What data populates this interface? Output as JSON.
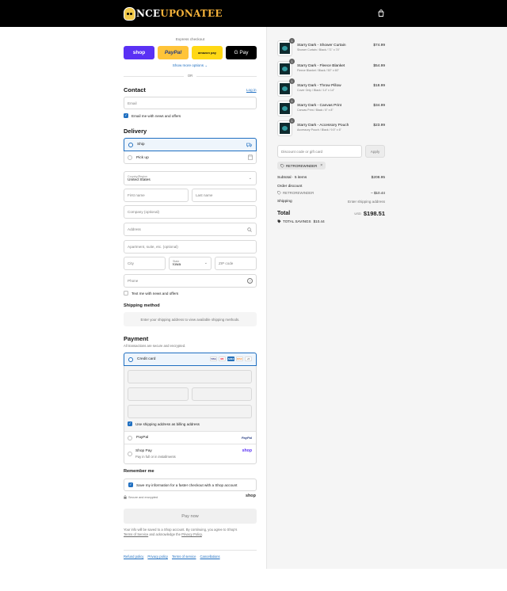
{
  "brand": {
    "logo_text_a": "NCE",
    "logo_text_b": "UPONATEE"
  },
  "express": {
    "title": "Express checkout",
    "shop_label": "shop",
    "paypal_label": "PayPal",
    "amazon_label": "amazon pay",
    "gpay_label": "G Pay",
    "show_more": "Show more options ⌄",
    "or": "OR"
  },
  "contact": {
    "heading": "Contact",
    "login": "Log in",
    "email_placeholder": "Email",
    "email_news": "Email me with news and offers"
  },
  "delivery": {
    "heading": "Delivery",
    "ship": "Ship",
    "pickup": "Pick up",
    "country_label": "Country/Region",
    "country_value": "United States",
    "first_name": "First name",
    "last_name": "Last name",
    "company": "Company (optional)",
    "address": "Address",
    "apartment": "Apartment, suite, etc. (optional)",
    "city": "City",
    "state_label": "State",
    "state_value": "Iowa",
    "zip": "ZIP code",
    "phone": "Phone",
    "text_news": "Text me with news and offers"
  },
  "shipping_method": {
    "heading": "Shipping method",
    "notice": "Enter your shipping address to view available shipping methods."
  },
  "payment": {
    "heading": "Payment",
    "sub": "All transactions are secure and encrypted.",
    "credit_card": "Credit card",
    "card_logos": [
      "VISA",
      "MC",
      "AMEX",
      "DISC"
    ],
    "more_cards": "+5",
    "billing_same": "Use shipping address as billing address",
    "paypal": "PayPal",
    "paypal_logo": "PayPal",
    "shop_pay": "Shop Pay",
    "shop_pay_sub": "Pay in full or in installments",
    "shop_logo": "shop"
  },
  "remember": {
    "heading": "Remember me",
    "save_info": "Save my information for a faster checkout with a Shop account",
    "secure": "Secure and encrypted",
    "shop_logo": "shop"
  },
  "pay_now": "Pay now",
  "legal": {
    "line1": "Your info will be saved to a Shop account. By continuing, you agree to Shop's",
    "terms": "Terms of Service",
    "and": " and acknowledge the ",
    "privacy": "Privacy Policy",
    "dot": "."
  },
  "footer_links": [
    "Refund policy",
    "Privacy policy",
    "Terms of service",
    "Cancellations"
  ],
  "order": {
    "items": [
      {
        "qty": "1",
        "title": "Starry Dark - Shower Curtain",
        "variant": "Shower Curtain / Black / 71\" x 74\"",
        "price": "$74.99"
      },
      {
        "qty": "1",
        "title": "Starry Dark - Fleece Blanket",
        "variant": "Fleece Blanket / Black / 50\" x 60\"",
        "price": "$54.99"
      },
      {
        "qty": "1",
        "title": "Starry Dark - Throw Pillow",
        "variant": "Cover Only / Black / 14\" x 14\"",
        "price": "$18.99"
      },
      {
        "qty": "1",
        "title": "Starry Dark - Canvas Print",
        "variant": "Canvas Print / Black / 8\" x 8\"",
        "price": "$34.99"
      },
      {
        "qty": "1",
        "title": "Starry Dark - Accessory Pouch",
        "variant": "Accessory Pouch / Black / 9.5\" x 6\"",
        "price": "$23.99"
      }
    ],
    "discount_placeholder": "Discount code or gift card",
    "apply": "Apply",
    "applied_code": "RETROREWINDER",
    "subtotal_label": "Subtotal · 5 items",
    "subtotal_value": "$208.95",
    "order_discount_label": "Order discount",
    "discount_code": "RETROREWINDER",
    "discount_value": "– $10.44",
    "shipping_label": "Shipping",
    "shipping_value": "Enter shipping address",
    "total_label": "Total",
    "currency": "USD",
    "total_value": "$198.51",
    "savings_label": "TOTAL SAVINGS",
    "savings_value": "$10.44"
  }
}
